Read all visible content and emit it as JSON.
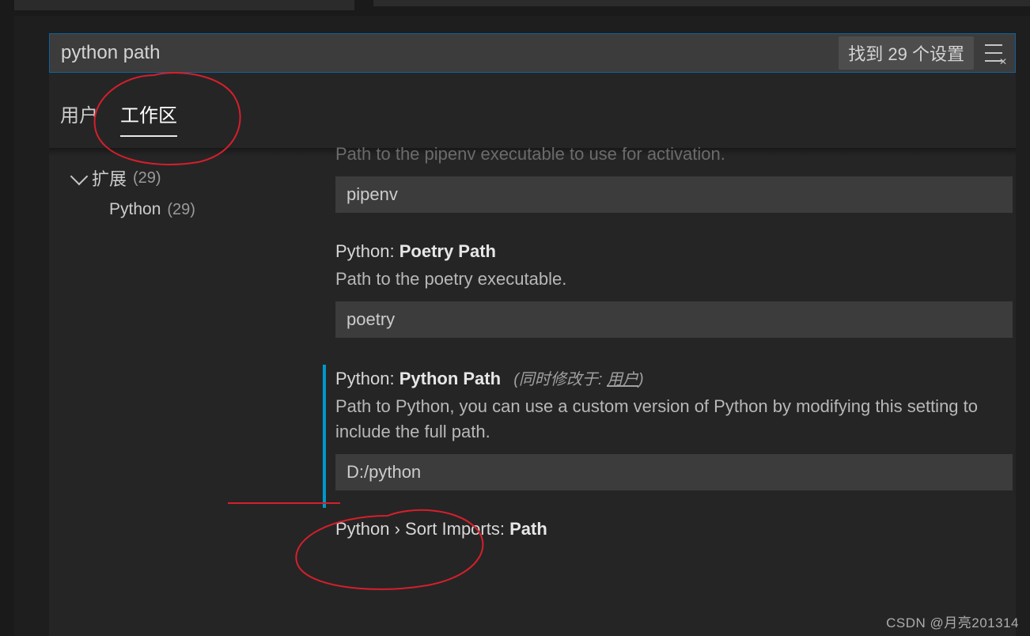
{
  "search": {
    "value": "python path",
    "results_label": "找到 29 个设置",
    "filter_icon": "settings-filter-icon"
  },
  "tabs": {
    "user": "用户",
    "workspace": "工作区",
    "active": "workspace"
  },
  "outline": {
    "group_label": "扩展",
    "group_count": "(29)",
    "items": [
      {
        "label": "Python",
        "count": "(29)"
      }
    ]
  },
  "settings": [
    {
      "id": "pipenv",
      "title_prefix": "",
      "title_name": "",
      "desc": "Path to the pipenv executable to use for activation.",
      "desc_dim": true,
      "input_value": "pipenv",
      "selected": false
    },
    {
      "id": "poetry",
      "title_prefix": "Python: ",
      "title_name": "Poetry Path",
      "desc": "Path to the poetry executable.",
      "input_value": "poetry",
      "selected": false
    },
    {
      "id": "pythonpath",
      "title_prefix": "Python: ",
      "title_name": "Python Path",
      "scope_prefix": "(同时修改于: ",
      "scope_link": "用户",
      "scope_suffix": ")",
      "desc": "Path to Python, you can use a custom version of Python by modifying this setting to include the full path.",
      "input_value": "D:/python",
      "selected": true
    },
    {
      "id": "sortimports",
      "title_prefix": "Python › Sort Imports: ",
      "title_name": "Path",
      "desc": "",
      "input_value": "",
      "selected": false,
      "title_only": true
    }
  ],
  "watermark": "CSDN @月亮201314"
}
